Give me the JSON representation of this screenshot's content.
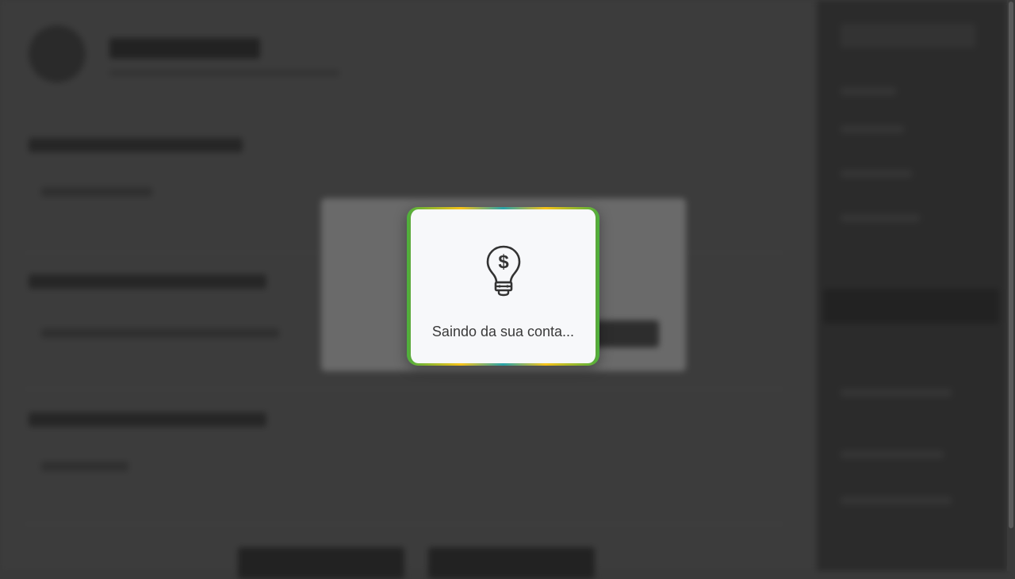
{
  "modal": {
    "message": "Saindo da sua conta...",
    "icon": "lightbulb-dollar-icon",
    "colors": {
      "border_green": "#4caf3c",
      "border_yellow": "#f6c218",
      "border_teal": "#29a3a9",
      "background": "#f7f8fa",
      "text": "#3a3a3a"
    }
  },
  "overlay": {
    "dim_color": "#3a3a3a"
  }
}
